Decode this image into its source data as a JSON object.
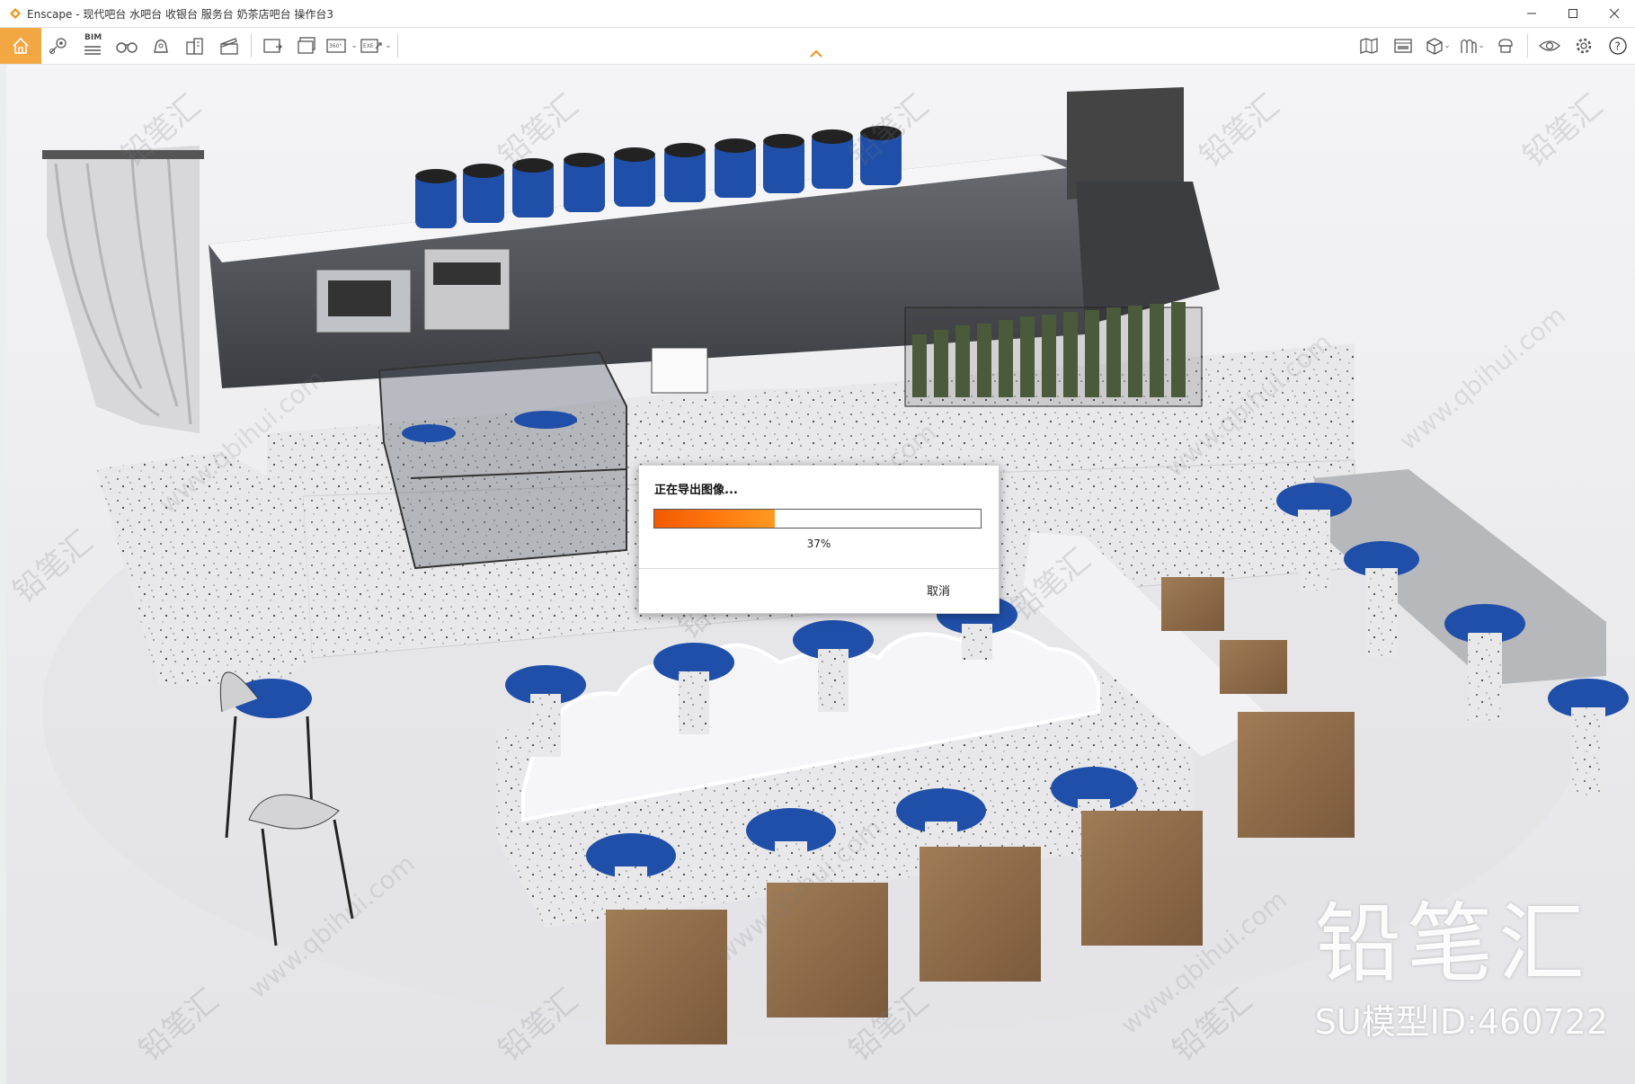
{
  "window": {
    "app_name": "Enscape",
    "title": "Enscape - 现代吧台 水吧台 收银台 服务台 奶茶店吧台 操作台3"
  },
  "toolbar": {
    "bim_label": "BIM",
    "panorama_label": "360°",
    "exe_label": "EXE",
    "accent_color": "#f2a742",
    "left_icons": [
      "home-icon",
      "location-pin-icon",
      "bim-list-icon",
      "binoculars-icon",
      "bell-icon",
      "buildings-icon",
      "clapperboard-icon",
      "render-image-icon",
      "batch-render-icon",
      "panorama-icon",
      "export-exe-icon"
    ],
    "right_icons": [
      "map-icon",
      "video-editor-icon",
      "cube-icon",
      "asset-library-icon",
      "upload-icon",
      "visual-settings-icon",
      "settings-gear-icon",
      "help-icon"
    ]
  },
  "dialog": {
    "title": "正在导出图像...",
    "progress": 0.37,
    "progress_text": "37%",
    "cancel_label": "取消",
    "progress_color": "#ff6a00"
  },
  "watermark": {
    "brand": "铅笔汇",
    "url": "www.qbihui.com",
    "model_id": "SU模型ID:460722"
  },
  "scene": {
    "accent_blue": "#1f4fa8",
    "wood": "#8b6a48"
  }
}
